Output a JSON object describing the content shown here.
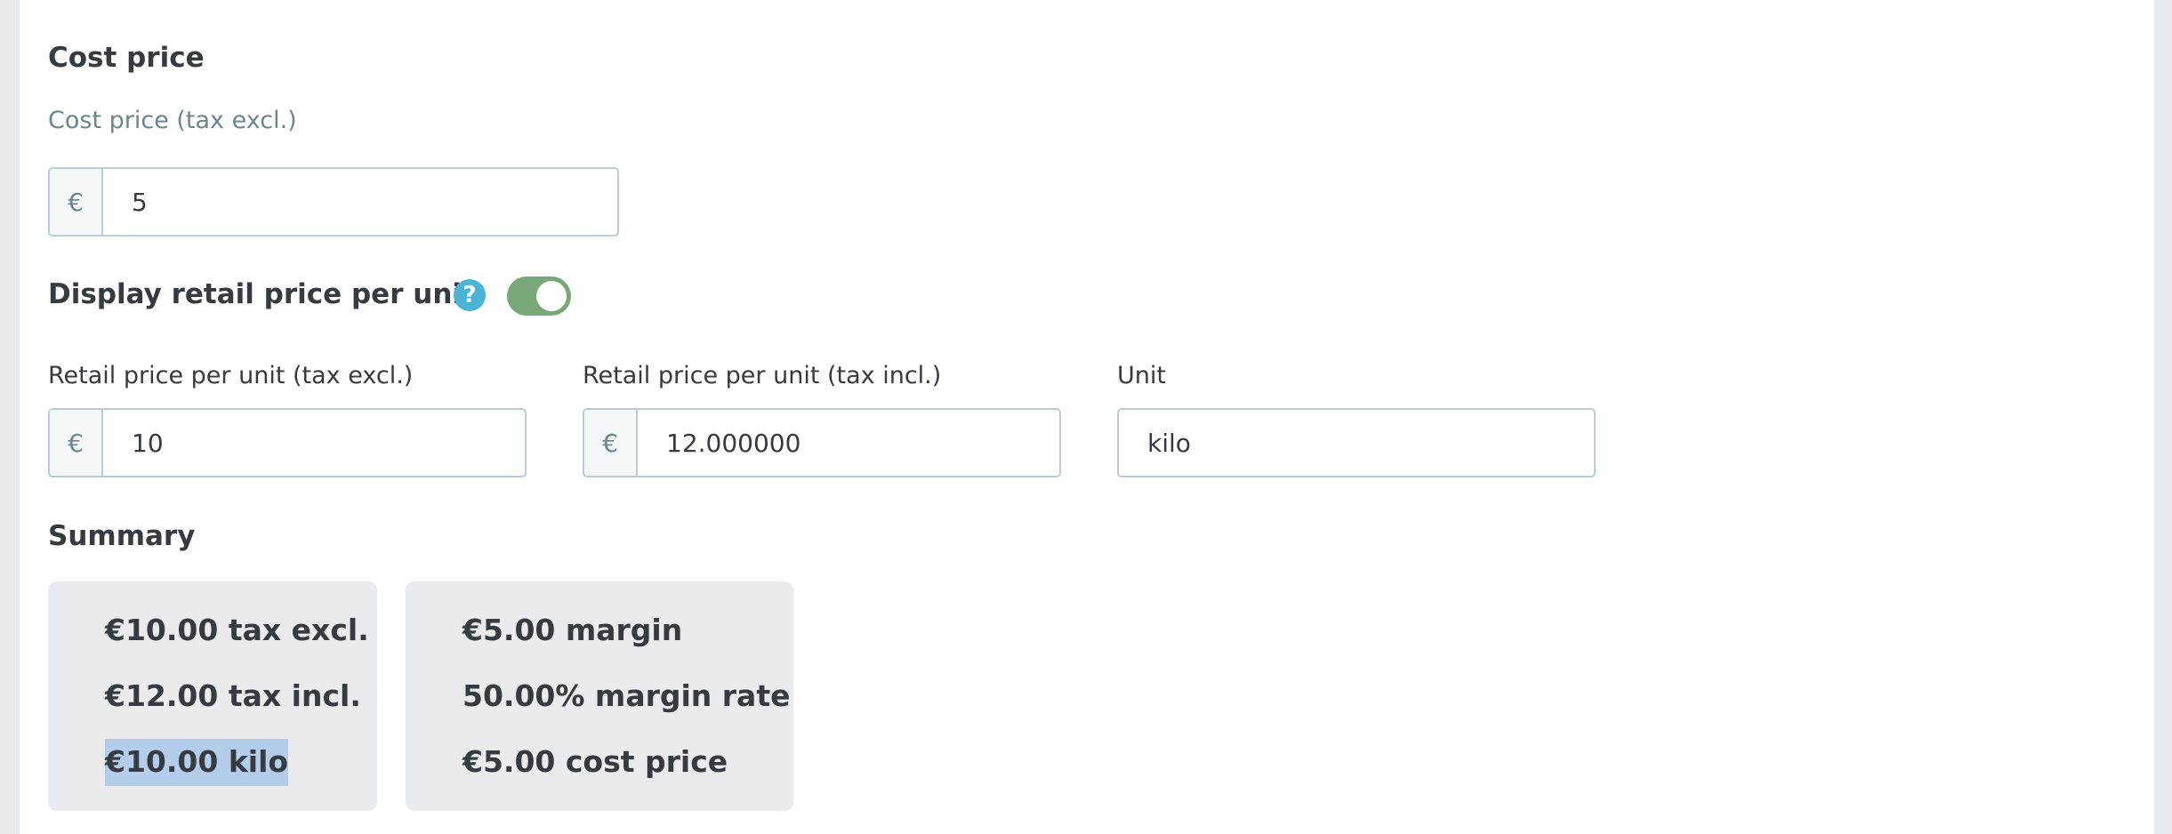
{
  "cost_price": {
    "section_title": "Cost price",
    "field_label": "Cost price (tax excl.)",
    "currency_symbol": "€",
    "value": "5"
  },
  "unit_price": {
    "section_title": "Display retail price per unit",
    "help_icon_glyph": "?",
    "toggle_enabled": true,
    "tax_excl": {
      "label": "Retail price per unit (tax excl.)",
      "currency_symbol": "€",
      "value": "10"
    },
    "tax_incl": {
      "label": "Retail price per unit (tax incl.)",
      "currency_symbol": "€",
      "value": "12.000000"
    },
    "unit": {
      "label": "Unit",
      "value": "kilo"
    }
  },
  "summary": {
    "title": "Summary",
    "card_prices": {
      "tax_excl": "€10.00 tax excl.",
      "tax_incl": "€12.00 tax incl.",
      "per_unit": "€10.00 kilo"
    },
    "card_margins": {
      "margin": "€5.00 margin",
      "margin_rate": "50.00% margin rate",
      "cost_price": "€5.00 cost price"
    }
  },
  "colors": {
    "toggle_on": "#78a87a",
    "help_icon": "#4bb3d4",
    "selection_highlight": "#b3cdea"
  }
}
